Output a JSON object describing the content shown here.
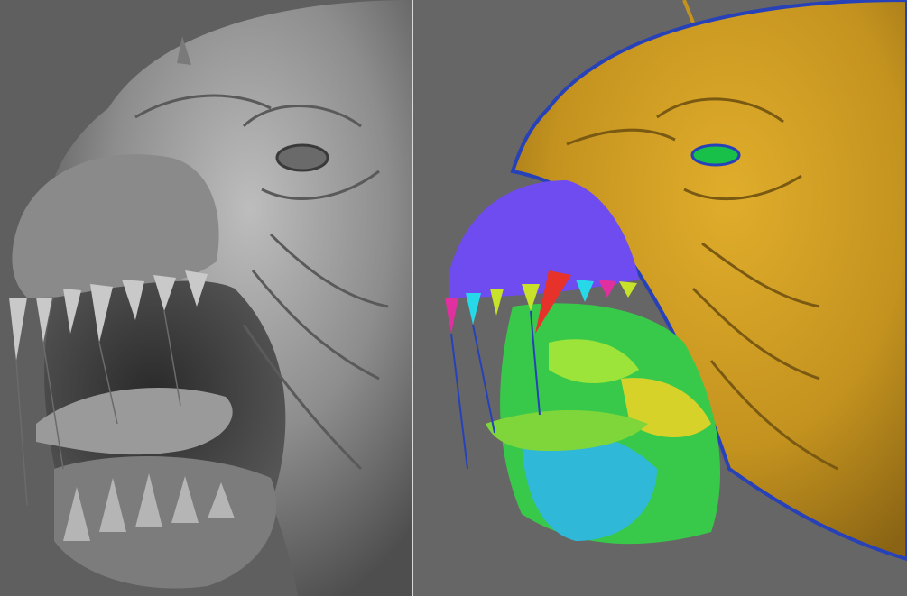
{
  "layout": {
    "left_panel": {
      "background": "#5f5f5f"
    },
    "right_panel": {
      "background": "#666666"
    },
    "divider_color": "#d9d9d9"
  },
  "left_render": {
    "style": "grey clay sculpt",
    "palette": {
      "base": "#8a8a8a",
      "light": "#b3b3b3",
      "shadow": "#3f3f3f"
    }
  },
  "right_render": {
    "style": "polygroup color view",
    "palette": {
      "skin": "#c4931f",
      "skin_dark": "#7a5a12",
      "eye": "#18c04a",
      "upper_jaw": "#6e4cf0",
      "teeth": [
        "#c8e12a",
        "#27d9e8",
        "#e0309f",
        "#e6322b"
      ],
      "throat": [
        "#39c94a",
        "#9ce33a",
        "#2fb8d8",
        "#d6d22a"
      ],
      "outline": "#2741b8"
    }
  }
}
